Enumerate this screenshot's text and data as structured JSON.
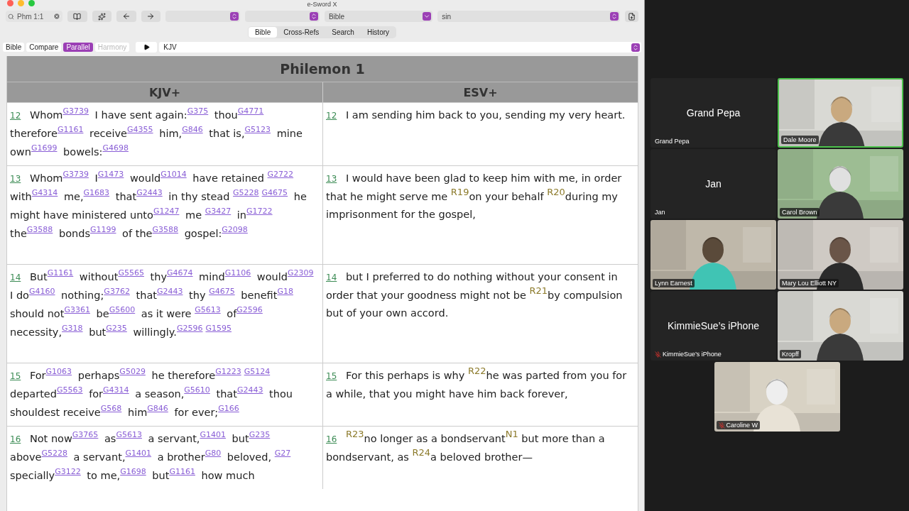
{
  "window": {
    "title": "e-Sword X"
  },
  "toolbar": {
    "search": {
      "value": "Phm 1:1"
    },
    "dropdowns": [
      {
        "kind": "blank"
      },
      {
        "kind": "blank"
      },
      {
        "kind": "single",
        "value": "Bible"
      },
      {
        "kind": "double",
        "value": "sin"
      }
    ]
  },
  "tabs": [
    {
      "label": "Bible",
      "selected": true
    },
    {
      "label": "Cross-Refs",
      "selected": false
    },
    {
      "label": "Search",
      "selected": false
    },
    {
      "label": "History",
      "selected": false
    }
  ],
  "view_modes": [
    {
      "label": "Bible",
      "selected": false,
      "disabled": false
    },
    {
      "label": "Compare",
      "selected": false,
      "disabled": false
    },
    {
      "label": "Parallel",
      "selected": true,
      "disabled": false
    },
    {
      "label": "Harmony",
      "selected": false,
      "disabled": true
    }
  ],
  "version_select": "KJV",
  "passage": {
    "title": "Philemon 1",
    "columns": [
      "KJV+",
      "ESV+"
    ],
    "verses": [
      {
        "number": "12",
        "esv_number": "12",
        "kjv": [
          {
            "kind": "text",
            "text": "Whom"
          },
          {
            "kind": "strong",
            "text": "G3739"
          },
          {
            "kind": "text",
            "text": " I have sent again:"
          },
          {
            "kind": "strong",
            "text": "G375"
          },
          {
            "kind": "text",
            "text": " thou"
          },
          {
            "kind": "strong",
            "text": "G4771"
          },
          {
            "kind": "text",
            "text": " therefore"
          },
          {
            "kind": "strong",
            "text": "G1161"
          },
          {
            "kind": "text",
            "text": " receive"
          },
          {
            "kind": "strong",
            "text": "G4355"
          },
          {
            "kind": "text",
            "text": " him,"
          },
          {
            "kind": "strong",
            "text": "G846"
          },
          {
            "kind": "text",
            "text": " that is,"
          },
          {
            "kind": "strong",
            "text": "G5123"
          },
          {
            "kind": "text",
            "text": " mine own"
          },
          {
            "kind": "strong",
            "text": "G1699"
          },
          {
            "kind": "text",
            "text": " bowels:"
          },
          {
            "kind": "strong",
            "text": "G4698"
          }
        ],
        "esv": [
          {
            "kind": "text",
            "text": "I am sending him back to you, sending my very heart."
          }
        ]
      },
      {
        "number": "13",
        "esv_number": "13",
        "kjv": [
          {
            "kind": "text",
            "text": "Whom"
          },
          {
            "kind": "strong",
            "text": "G3739"
          },
          {
            "kind": "text",
            "text": " I"
          },
          {
            "kind": "strong",
            "text": "G1473"
          },
          {
            "kind": "text",
            "text": " would"
          },
          {
            "kind": "strong",
            "text": "G1014"
          },
          {
            "kind": "text",
            "text": " have retained "
          },
          {
            "kind": "strong",
            "text": "G2722"
          },
          {
            "kind": "text",
            "text": " with"
          },
          {
            "kind": "strong",
            "text": "G4314"
          },
          {
            "kind": "text",
            "text": " me,"
          },
          {
            "kind": "strong",
            "text": "G1683"
          },
          {
            "kind": "text",
            "text": " that"
          },
          {
            "kind": "strong",
            "text": "G2443"
          },
          {
            "kind": "text",
            "text": " in thy stead "
          },
          {
            "kind": "strong",
            "text": "G5228"
          },
          {
            "kind": "strong",
            "text": "G4675"
          },
          {
            "kind": "text",
            "text": " he might have ministered unto"
          },
          {
            "kind": "strong",
            "text": "G1247"
          },
          {
            "kind": "text",
            "text": " me "
          },
          {
            "kind": "strong",
            "text": "G3427"
          },
          {
            "kind": "text",
            "text": " in"
          },
          {
            "kind": "strong",
            "text": "G1722"
          },
          {
            "kind": "text",
            "text": " the"
          },
          {
            "kind": "strong",
            "text": "G3588"
          },
          {
            "kind": "text",
            "text": " bonds"
          },
          {
            "kind": "strong",
            "text": "G1199"
          },
          {
            "kind": "text",
            "text": " of the"
          },
          {
            "kind": "strong",
            "text": "G3588"
          },
          {
            "kind": "text",
            "text": " gospel:"
          },
          {
            "kind": "strong",
            "text": "G2098"
          }
        ],
        "esv": [
          {
            "kind": "text",
            "text": "I would have been glad to keep him with me, in order that he might serve me "
          },
          {
            "kind": "ref",
            "text": "R19"
          },
          {
            "kind": "text",
            "text": "on your behalf "
          },
          {
            "kind": "ref",
            "text": "R20"
          },
          {
            "kind": "text",
            "text": "during my imprisonment for the gospel,"
          }
        ]
      },
      {
        "number": "14",
        "esv_number": "14",
        "kjv": [
          {
            "kind": "text",
            "text": "But"
          },
          {
            "kind": "strong",
            "text": "G1161"
          },
          {
            "kind": "text",
            "text": " without"
          },
          {
            "kind": "strong",
            "text": "G5565"
          },
          {
            "kind": "text",
            "text": " thy"
          },
          {
            "kind": "strong",
            "text": "G4674"
          },
          {
            "kind": "text",
            "text": " mind"
          },
          {
            "kind": "strong",
            "text": "G1106"
          },
          {
            "kind": "text",
            "text": " would"
          },
          {
            "kind": "strong",
            "text": "G2309"
          },
          {
            "kind": "text",
            "text": " I do"
          },
          {
            "kind": "strong",
            "text": "G4160"
          },
          {
            "kind": "text",
            "text": " nothing;"
          },
          {
            "kind": "strong",
            "text": "G3762"
          },
          {
            "kind": "text",
            "text": " that"
          },
          {
            "kind": "strong",
            "text": "G2443"
          },
          {
            "kind": "text",
            "text": " thy "
          },
          {
            "kind": "strong",
            "text": "G4675"
          },
          {
            "kind": "text",
            "text": " benefit"
          },
          {
            "kind": "strong",
            "text": "G18"
          },
          {
            "kind": "text",
            "text": " should not"
          },
          {
            "kind": "strong",
            "text": "G3361"
          },
          {
            "kind": "text",
            "text": " be"
          },
          {
            "kind": "strong",
            "text": "G5600"
          },
          {
            "kind": "text",
            "text": " as it were "
          },
          {
            "kind": "strong",
            "text": "G5613"
          },
          {
            "kind": "text",
            "text": " of"
          },
          {
            "kind": "strong",
            "text": "G2596"
          },
          {
            "kind": "text",
            "text": " necessity,"
          },
          {
            "kind": "strong",
            "text": "G318"
          },
          {
            "kind": "text",
            "text": " but"
          },
          {
            "kind": "strong",
            "text": "G235"
          },
          {
            "kind": "text",
            "text": " willingly."
          },
          {
            "kind": "strong",
            "text": "G2596"
          },
          {
            "kind": "strong",
            "text": "G1595"
          }
        ],
        "esv": [
          {
            "kind": "text",
            "text": "but I preferred to do nothing without your consent in order that your goodness might not be "
          },
          {
            "kind": "ref",
            "text": "R21"
          },
          {
            "kind": "text",
            "text": "by compulsion but of your own accord."
          }
        ]
      },
      {
        "number": "15",
        "esv_number": "15",
        "kjv": [
          {
            "kind": "text",
            "text": "For"
          },
          {
            "kind": "strong",
            "text": "G1063"
          },
          {
            "kind": "text",
            "text": " perhaps"
          },
          {
            "kind": "strong",
            "text": "G5029"
          },
          {
            "kind": "text",
            "text": " he therefore"
          },
          {
            "kind": "strong",
            "text": "G1223"
          },
          {
            "kind": "strong",
            "text": "G5124"
          },
          {
            "kind": "text",
            "text": " departed"
          },
          {
            "kind": "strong",
            "text": "G5563"
          },
          {
            "kind": "text",
            "text": " for"
          },
          {
            "kind": "strong",
            "text": "G4314"
          },
          {
            "kind": "text",
            "text": " a season,"
          },
          {
            "kind": "strong",
            "text": "G5610"
          },
          {
            "kind": "text",
            "text": " that"
          },
          {
            "kind": "strong",
            "text": "G2443"
          },
          {
            "kind": "text",
            "text": " thou shouldest receive"
          },
          {
            "kind": "strong",
            "text": "G568"
          },
          {
            "kind": "text",
            "text": " him"
          },
          {
            "kind": "strong",
            "text": "G846"
          },
          {
            "kind": "text",
            "text": " for ever;"
          },
          {
            "kind": "strong",
            "text": "G166"
          }
        ],
        "esv": [
          {
            "kind": "text",
            "text": "For this perhaps is why "
          },
          {
            "kind": "ref",
            "text": "R22"
          },
          {
            "kind": "text",
            "text": "he was parted from you for a while, that you might have him back forever,"
          }
        ]
      },
      {
        "number": "16",
        "esv_number": "16",
        "kjv": [
          {
            "kind": "text",
            "text": "Not now"
          },
          {
            "kind": "strong",
            "text": "G3765"
          },
          {
            "kind": "text",
            "text": " as"
          },
          {
            "kind": "strong",
            "text": "G5613"
          },
          {
            "kind": "text",
            "text": " a servant,"
          },
          {
            "kind": "strong",
            "text": "G1401"
          },
          {
            "kind": "text",
            "text": " but"
          },
          {
            "kind": "strong",
            "text": "G235"
          },
          {
            "kind": "text",
            "text": " above"
          },
          {
            "kind": "strong",
            "text": "G5228"
          },
          {
            "kind": "text",
            "text": " a servant,"
          },
          {
            "kind": "strong",
            "text": "G1401"
          },
          {
            "kind": "text",
            "text": " a brother"
          },
          {
            "kind": "strong",
            "text": "G80"
          },
          {
            "kind": "text",
            "text": " beloved, "
          },
          {
            "kind": "strong",
            "text": "G27"
          },
          {
            "kind": "text",
            "text": " specially"
          },
          {
            "kind": "strong",
            "text": "G3122"
          },
          {
            "kind": "text",
            "text": " to me,"
          },
          {
            "kind": "strong",
            "text": "G1698"
          },
          {
            "kind": "text",
            "text": " but"
          },
          {
            "kind": "strong",
            "text": "G1161"
          },
          {
            "kind": "text",
            "text": " how much"
          }
        ],
        "esv": [
          {
            "kind": "ref",
            "text": "R23"
          },
          {
            "kind": "text",
            "text": "no longer as a bondservant"
          },
          {
            "kind": "note",
            "text": "N1"
          },
          {
            "kind": "text",
            "text": " but more than a bondservant, as "
          },
          {
            "kind": "ref",
            "text": "R24"
          },
          {
            "kind": "text",
            "text": "a beloved brother—"
          }
        ]
      }
    ]
  },
  "meeting": {
    "participants": [
      {
        "name": "Grand Pepa",
        "label": "Grand Pepa",
        "kind": "name",
        "muted": false,
        "speaking": false
      },
      {
        "label": "Dale Moore",
        "kind": "video",
        "muted": false,
        "speaking": true
      },
      {
        "name": "Jan",
        "label": "Jan",
        "kind": "name",
        "muted": false,
        "speaking": false
      },
      {
        "label": "Carol Brown",
        "kind": "video",
        "muted": false,
        "speaking": false
      },
      {
        "label": "Lynn Earnest",
        "kind": "video",
        "muted": false,
        "speaking": false
      },
      {
        "label": "Mary Lou Elliott NY",
        "kind": "video",
        "muted": false,
        "speaking": false
      },
      {
        "name": "KimmieSue’s  iPhone",
        "label": "KimmieSue’s  iPhone",
        "kind": "name",
        "muted": true,
        "speaking": false
      },
      {
        "label": "Kropff",
        "kind": "video",
        "muted": false,
        "speaking": false
      },
      {
        "label": "Caroline W",
        "kind": "video",
        "muted": true,
        "speaking": false
      }
    ]
  }
}
